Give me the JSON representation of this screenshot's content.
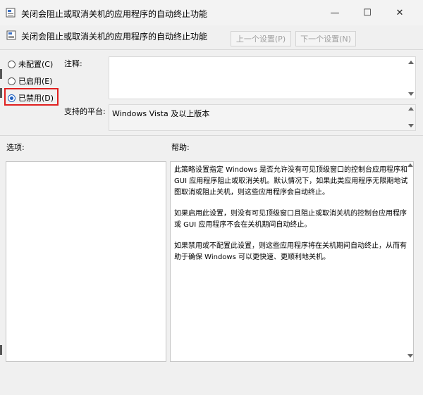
{
  "window": {
    "title": "关闭会阻止或取消关机的应用程序的自动终止功能",
    "minimize_glyph": "—",
    "maximize_glyph": "☐",
    "close_glyph": "✕"
  },
  "header": {
    "policy_title": "关闭会阻止或取消关机的应用程序的自动终止功能",
    "prev_label": "上一个设置(P)",
    "next_label": "下一个设置(N)"
  },
  "options": {
    "not_configured": "未配置(C)",
    "enabled": "已启用(E)",
    "disabled": "已禁用(D)",
    "selected": "disabled"
  },
  "comment": {
    "label": "注释:",
    "value": ""
  },
  "platform": {
    "label": "支持的平台:",
    "value": "Windows Vista 及以上版本"
  },
  "sections": {
    "options_label": "选项:",
    "help_label": "帮助:"
  },
  "help": {
    "paragraphs": [
      "此策略设置指定 Windows 是否允许没有可见顶级窗口的控制台应用程序和 GUI 应用程序阻止或取消关机。默认情况下，如果此类应用程序无限期地试图取消或阻止关机，则这些应用程序会自动终止。",
      "如果启用此设置，则没有可见顶级窗口且阻止或取消关机的控制台应用程序或 GUI 应用程序不会在关机期间自动终止。",
      "如果禁用或不配置此设置，则这些应用程序将在关机期间自动终止，从而有助于确保 Windows 可以更快速、更顺利地关机。"
    ]
  },
  "colors": {
    "highlight_box": "#e02020",
    "radio_accent": "#1f5fbf"
  }
}
